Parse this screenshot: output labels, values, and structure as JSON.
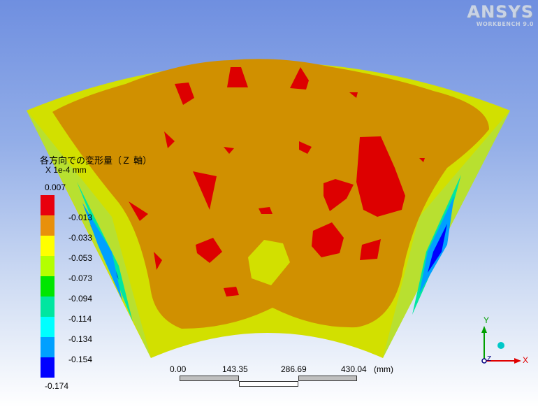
{
  "brand": {
    "name": "ANSYS",
    "subtitle": "WORKBENCH 9.0"
  },
  "legend": {
    "title": "各方向での変形量（Ｚ 軸）",
    "scale_factor": "X 1e-4 mm",
    "top_value": "0.007",
    "levels": [
      {
        "label": "-0.013",
        "color": "#e8000e"
      },
      {
        "label": "-0.033",
        "color": "#e8900b"
      },
      {
        "label": "-0.053",
        "color": "#ffff00"
      },
      {
        "label": "-0.073",
        "color": "#b4ff00"
      },
      {
        "label": "-0.094",
        "color": "#00e600"
      },
      {
        "label": "-0.114",
        "color": "#00e6a0"
      },
      {
        "label": "-0.134",
        "color": "#00ffff"
      },
      {
        "label": "-0.154",
        "color": "#00a0ff"
      },
      {
        "label": "-0.174",
        "color": "#0000ff"
      }
    ],
    "bottom_value": "-0.174"
  },
  "scale_bar": {
    "ticks": [
      "0.00",
      "143.35",
      "286.69",
      "430.04"
    ],
    "unit": "(mm)"
  },
  "triad": {
    "y": "Y",
    "z": "Z",
    "x": "X"
  },
  "colors": {
    "deep_orange": "#d09000",
    "red": "#dd0000",
    "yellow_green": "#d2e000",
    "light_green": "#b8e030"
  }
}
